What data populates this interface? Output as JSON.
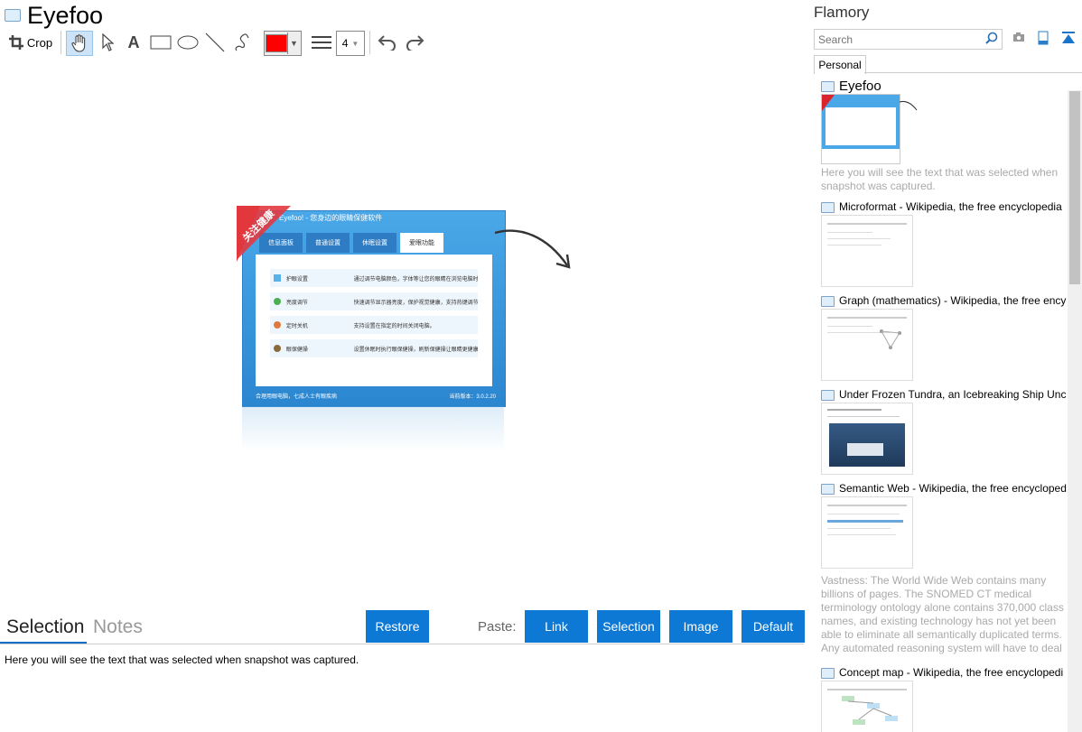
{
  "app": {
    "title": "Eyefoo"
  },
  "toolbar": {
    "crop_label": "Crop",
    "line_width": "4",
    "color": "#ff0000",
    "tools": [
      "hand-icon",
      "pointer-icon",
      "text-icon",
      "rectangle-icon",
      "ellipse-icon",
      "line-icon",
      "freehand-icon"
    ]
  },
  "snapshot": {
    "window_title": "Eyefoo! - 您身边的眼睛保健软件",
    "ribbon": "关注健康",
    "tabs": [
      "信息面板",
      "普通设置",
      "休眠设置",
      "爱眼功能"
    ],
    "rows": [
      {
        "label": "护眼设置",
        "desc": "通过调节电脑颜色，字体等让您的眼睛在浏览电脑时更加舒适。"
      },
      {
        "label": "亮度调节",
        "desc": "快速调节显示器亮度，保护视觉健康，支持热键调节。"
      },
      {
        "label": "定时关机",
        "desc": "支持设置在指定的时间关闭电脑。"
      },
      {
        "label": "眼保健操",
        "desc": "设置休眠时执行眼保健操，刷新保健操让眼睛更健康。"
      }
    ],
    "footer_left": "合理用眼电脑，七成人士有眼疾病",
    "footer_right": "当前版本：3.0.2.20"
  },
  "bottom": {
    "tab_selection": "Selection",
    "tab_notes": "Notes",
    "restore": "Restore",
    "paste_label": "Paste:",
    "paste_link": "Link",
    "paste_selection": "Selection",
    "paste_image": "Image",
    "paste_default": "Default",
    "selection_text": "Here you will see the text that was selected when snapshot was captured."
  },
  "sidebar": {
    "title": "Flamory",
    "search_placeholder": "Search",
    "tab": "Personal",
    "items": [
      {
        "title": "Eyefoo",
        "desc": "Here you will see the text that was selected when snapshot was captured."
      },
      {
        "title": "Microformat - Wikipedia, the free encyclopedia",
        "desc": ""
      },
      {
        "title": "Graph (mathematics) - Wikipedia, the free encyc",
        "desc": ""
      },
      {
        "title": "Under Frozen Tundra, an Icebreaking Ship Unco",
        "desc": ""
      },
      {
        "title": "Semantic Web - Wikipedia, the free encycloped",
        "desc": "Vastness: The World Wide Web contains many billions of pages. The SNOMED CT medical terminology ontology alone contains 370,000 class names, and existing technology has not yet been able to eliminate all semantically duplicated terms. Any automated reasoning system will have to deal with truly huge inputs."
      },
      {
        "title": "Concept map - Wikipedia, the free encyclopedi",
        "desc": ""
      }
    ]
  },
  "colors": {
    "accent": "#0e78d5",
    "selection_tab_underline": "#0e6fc7"
  }
}
